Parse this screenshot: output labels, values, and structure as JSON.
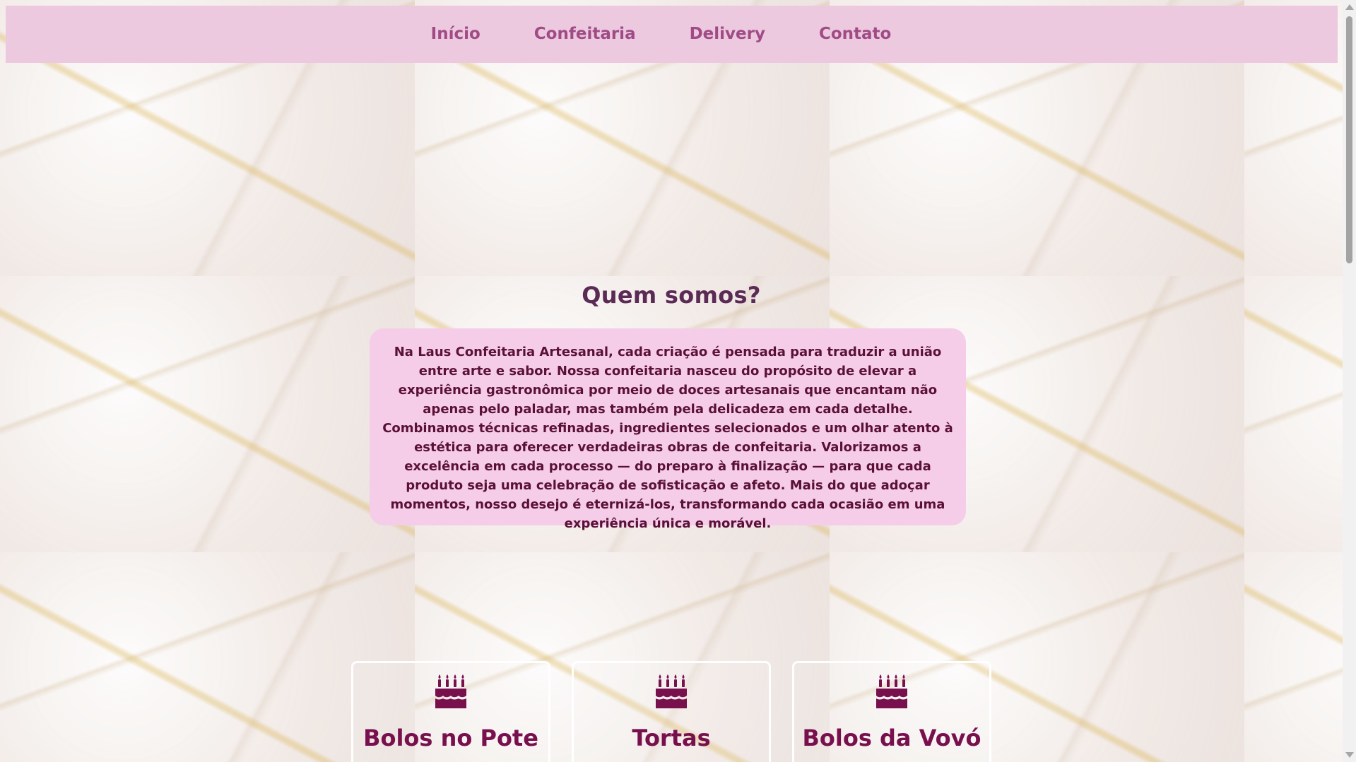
{
  "navbar": {
    "items": [
      {
        "label": "Início"
      },
      {
        "label": "Confeitaria"
      },
      {
        "label": "Delivery"
      },
      {
        "label": "Contato"
      }
    ]
  },
  "about": {
    "title": "Quem somos?",
    "text": "Na Laus Confeitaria Artesanal, cada criação é pensada para traduzir a união entre arte e sabor. Nossa confeitaria nasceu do propósito de elevar a experiência gastronômica por meio de doces artesanais que encantam não apenas pelo paladar, mas também pela delicadeza em cada detalhe. Combinamos técnicas refinadas, ingredientes selecionados e um olhar atento à estética para oferecer verdadeiras obras de confeitaria. Valorizamos a excelência em cada processo — do preparo à finalização — para que cada produto seja uma celebração de sofisticação e afeto. Mais do que adoçar momentos, nosso desejo é eternizá-los, transformando cada ocasião em uma experiência única e morável."
  },
  "products": [
    {
      "title": "Bolos no Pote",
      "icon": "cake-icon"
    },
    {
      "title": "Tortas",
      "icon": "cake-icon"
    },
    {
      "title": "Bolos da Vovó",
      "icon": "cake-icon"
    }
  ],
  "colors": {
    "nav_bg": "#ecc9df",
    "nav_text": "#a04b86",
    "card_bg": "#f5cde8",
    "accent_dark": "#78104e"
  }
}
